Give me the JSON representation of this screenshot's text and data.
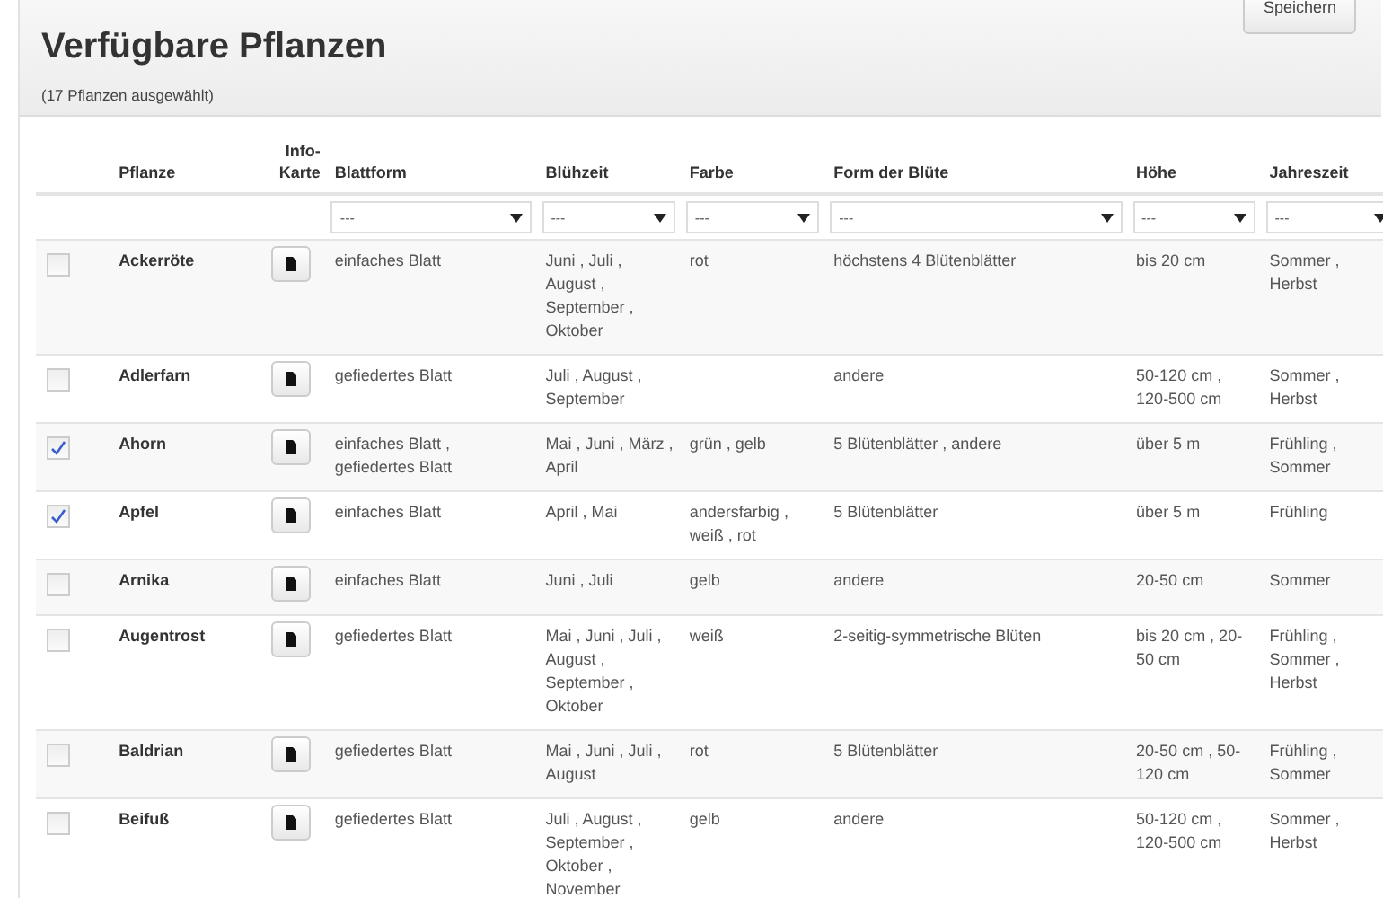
{
  "header": {
    "title": "Verfügbare Pflanzen",
    "subtitle": "(17 Pflanzen ausgewählt)",
    "save_button": "Speichern"
  },
  "table": {
    "columns": [
      {
        "kind": "check"
      },
      {
        "kind": "text",
        "label": "Pflanze"
      },
      {
        "kind": "info",
        "label": "Info-Karte"
      },
      {
        "kind": "text",
        "label": "Blattform"
      },
      {
        "kind": "text",
        "label": "Blühzeit"
      },
      {
        "kind": "text",
        "label": "Farbe"
      },
      {
        "kind": "text",
        "label": "Form der Blüte"
      },
      {
        "kind": "text",
        "label": "Höhe"
      },
      {
        "kind": "text",
        "label": "Jahreszeit"
      }
    ],
    "filters": [
      "---",
      "---",
      "---",
      "---",
      "---",
      "---"
    ],
    "rows": [
      {
        "selected": false,
        "name": "Ackerröte",
        "blattform": "einfaches Blatt",
        "bluehzeit": "Juni , Juli , August , September , Oktober",
        "farbe": "rot",
        "form": "höchstens 4 Blütenblätter",
        "hoehe": "bis 20 cm",
        "jahreszeit": "Sommer , Herbst"
      },
      {
        "selected": false,
        "name": "Adlerfarn",
        "blattform": "gefiedertes Blatt",
        "bluehzeit": "Juli , August , September",
        "farbe": "",
        "form": "andere",
        "hoehe": "50-120 cm , 120-500 cm",
        "jahreszeit": "Sommer , Herbst"
      },
      {
        "selected": true,
        "name": "Ahorn",
        "blattform": "einfaches Blatt , gefiedertes Blatt",
        "bluehzeit": "Mai , Juni , März , April",
        "farbe": "grün , gelb",
        "form": "5 Blütenblätter , andere",
        "hoehe": "über 5 m",
        "jahreszeit": "Frühling , Sommer"
      },
      {
        "selected": true,
        "name": "Apfel",
        "blattform": "einfaches Blatt",
        "bluehzeit": "April , Mai",
        "farbe": "andersfarbig , weiß , rot",
        "form": "5 Blütenblätter",
        "hoehe": "über 5 m",
        "jahreszeit": "Frühling"
      },
      {
        "selected": false,
        "name": "Arnika",
        "blattform": "einfaches Blatt",
        "bluehzeit": "Juni , Juli",
        "farbe": "gelb",
        "form": "andere",
        "hoehe": "20-50 cm",
        "jahreszeit": "Sommer"
      },
      {
        "selected": false,
        "name": "Augentrost",
        "blattform": "gefiedertes Blatt",
        "bluehzeit": "Mai , Juni , Juli , August , September , Oktober",
        "farbe": "weiß",
        "form": "2-seitig-symmetrische Blüten",
        "hoehe": "bis 20 cm , 20-50 cm",
        "jahreszeit": "Frühling , Sommer , Herbst"
      },
      {
        "selected": false,
        "name": "Baldrian",
        "blattform": "gefiedertes Blatt",
        "bluehzeit": "Mai , Juni , Juli , August",
        "farbe": "rot",
        "form": "5 Blütenblätter",
        "hoehe": "20-50 cm , 50-120 cm",
        "jahreszeit": "Frühling , Sommer"
      },
      {
        "selected": false,
        "name": "Beifuß",
        "blattform": "gefiedertes Blatt",
        "bluehzeit": "Juli , August , September , Oktober , November",
        "farbe": "gelb",
        "form": "andere",
        "hoehe": "50-120 cm , 120-500 cm",
        "jahreszeit": "Sommer , Herbst"
      }
    ]
  }
}
